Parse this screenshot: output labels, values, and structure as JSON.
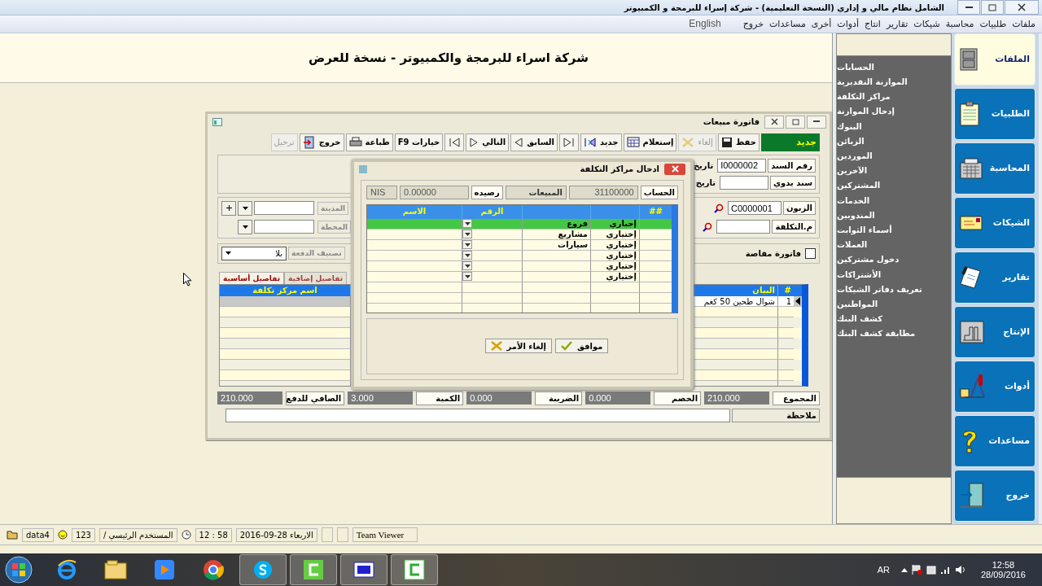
{
  "app_title": "الشامل نظام مالي و إداري  (النسخة التعليمية) - شركة إسراء للبرمجة و الكمبيوتر",
  "menu": [
    "ملفات",
    "طلبيات",
    "محاسبة",
    "شيكات",
    "تقارير",
    "انتاج",
    "أدوات",
    "أخرى",
    "مساعدات",
    "خروج"
  ],
  "language_button": "English",
  "company_banner": "شركة اسراء للبرمجة والكمبيوتر - نسخة للعرض",
  "side_menu": [
    "الحسابات",
    "الموازنة التقديرية",
    "مراكز التكلفة",
    "إدخال الموازنة",
    "البنوك",
    "الزبائن",
    "الموردين",
    "الآخرين",
    "المشتركين",
    "الخدمات",
    "المندوبين",
    "أسماء الثوابت",
    "العملات",
    "دخول مشتركين",
    "الأشتراكات",
    "تعريف دفاتر الشيكات",
    "المواطنين",
    "كشف البنك",
    "مطابقة كشف البنك"
  ],
  "nav": [
    {
      "label": "الملفات",
      "selected": true
    },
    {
      "label": "الطلبيات",
      "selected": false
    },
    {
      "label": "المحاسبة",
      "selected": false
    },
    {
      "label": "الشيكات",
      "selected": false
    },
    {
      "label": "تقارير",
      "selected": false
    },
    {
      "label": "الإنتاج",
      "selected": false
    },
    {
      "label": "أدوات",
      "selected": false
    },
    {
      "label": "مساعدات",
      "selected": false
    },
    {
      "label": "خروج",
      "selected": false
    }
  ],
  "invoice": {
    "title": "فاتورة مبيعات",
    "status": "جديد",
    "toolbar": [
      {
        "kind": "text",
        "label": "حفظ",
        "disabled": false
      },
      {
        "kind": "text",
        "label": "إلغاء",
        "disabled": true
      },
      {
        "kind": "text",
        "label": "إستعلام",
        "disabled": false
      },
      {
        "kind": "text",
        "label": "جديد",
        "disabled": false
      },
      {
        "kind": "icon",
        "disabled": false
      },
      {
        "kind": "text",
        "label": "السابق",
        "disabled": false
      },
      {
        "kind": "text",
        "label": "التالي",
        "disabled": false
      },
      {
        "kind": "icon",
        "disabled": false
      },
      {
        "kind": "text",
        "label": "خيارات F9",
        "disabled": false
      },
      {
        "kind": "text",
        "label": "طباعة",
        "disabled": false
      },
      {
        "kind": "text",
        "label": "خروج",
        "disabled": false
      },
      {
        "kind": "text",
        "label": "ترحيل",
        "disabled": true
      }
    ],
    "doc_number_label": "رقم السند",
    "doc_number": "I0000002",
    "date_label": "تاريخ",
    "manual_doc_label": "سند يدوي",
    "date2_label": "تاريخ",
    "customer_label": "الزبون",
    "customer": "C0000001",
    "city_label": "المدينة",
    "cost_center_label": "م.التكلفة",
    "station_label": "المحطة",
    "offset_invoice": {
      "label": "فاتورة مقاصة",
      "checked": false
    },
    "payment_class_label": "تصنيف الدفعة",
    "payment_class": "بلا",
    "tabs": [
      {
        "label": "تفاصيل إضافية",
        "selected": false
      },
      {
        "label": "تفاصيل أساسية",
        "selected": true
      }
    ],
    "columns": [
      "#",
      "البيان",
      "اسم مركز تكلفة"
    ],
    "rows": [
      {
        "number": "1",
        "description": "شوال طحين 50 كغم",
        "selected": true
      }
    ],
    "totals": [
      {
        "label": "المجموع",
        "value": "210.000"
      },
      {
        "label": "الخصم",
        "value": "0.000"
      },
      {
        "label": "الضريبة",
        "value": "0.000"
      },
      {
        "label": "الكمية",
        "value": "3.000"
      },
      {
        "label": "الصافي للدفع",
        "value": "210.000"
      }
    ],
    "note_label": "ملاحظة"
  },
  "dialog": {
    "title": "ادخال مراكز التكلفة",
    "account_label": "الحساب",
    "account": "31100000",
    "account_name": "المبيعات",
    "balance_label": "رصيده",
    "balance": "0.00000",
    "currency": "NIS",
    "columns": [
      "##",
      "الرقم",
      "الاسم"
    ],
    "rows": [
      {
        "requirement": "إجباري",
        "category": "فروع",
        "selected": true
      },
      {
        "requirement": "إختياري",
        "category": "مشاريع",
        "selected": false
      },
      {
        "requirement": "إختياري",
        "category": "سيارات",
        "selected": false
      },
      {
        "requirement": "إختياري",
        "selected": false
      },
      {
        "requirement": "إختياري",
        "selected": false
      },
      {
        "requirement": "إختياري",
        "selected": false
      }
    ],
    "ok": "موافق",
    "cancel": "إلغاء الأمر"
  },
  "status_bar": {
    "database": "data4",
    "user_id": "123",
    "user": "المستخدم الرئيسي /",
    "time": "12 : 58",
    "date": "الاربعاء 28-09-2016",
    "remote": "Team Viewer"
  },
  "taskbar": {
    "language": "AR",
    "time": "12:58",
    "date": "28/09/2016"
  }
}
